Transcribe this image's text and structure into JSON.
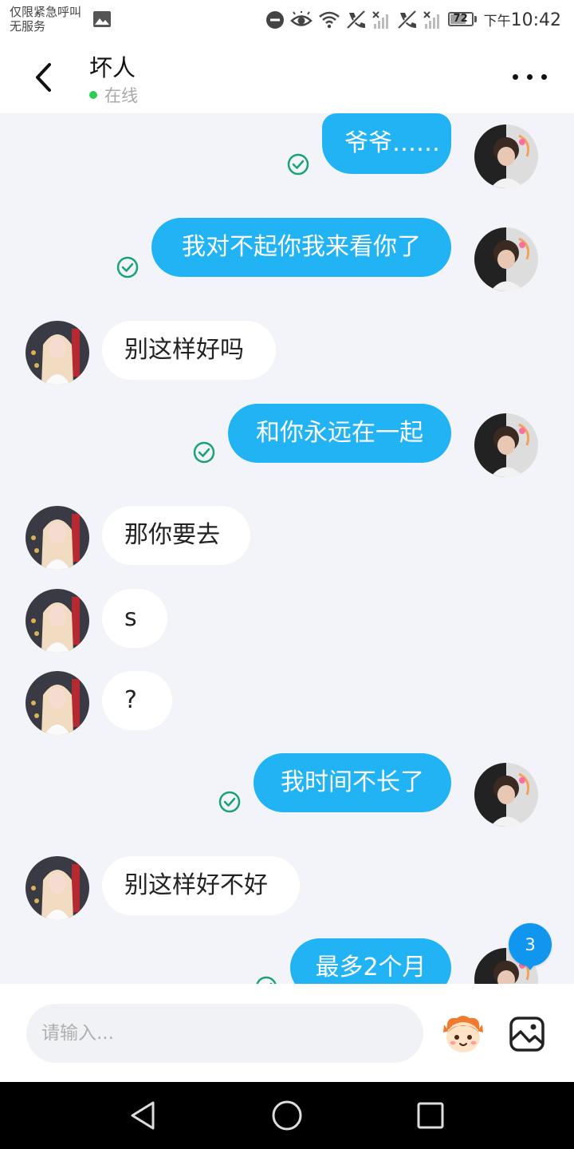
{
  "status_bar": {
    "carrier_line1": "仅限紧急呼叫",
    "carrier_line2": "无服务",
    "battery_level": "72",
    "battery_fraction": 0.72,
    "time_prefix": "下午",
    "time": "10:42"
  },
  "header": {
    "contact_name": "坏人",
    "presence": "在线",
    "presence_color": "#2ecc55"
  },
  "messages": [
    {
      "direction": "outgoing",
      "text": "爷爷……",
      "delivered": true
    },
    {
      "direction": "outgoing",
      "text": "我对不起你我来看你了",
      "delivered": true
    },
    {
      "direction": "incoming",
      "text": "别这样好吗"
    },
    {
      "direction": "outgoing",
      "text": "和你永远在一起",
      "delivered": true
    },
    {
      "direction": "incoming",
      "text": "那你要去"
    },
    {
      "direction": "incoming",
      "text": "s"
    },
    {
      "direction": "incoming",
      "text": "?"
    },
    {
      "direction": "outgoing",
      "text": "我时间不长了",
      "delivered": true
    },
    {
      "direction": "incoming",
      "text": "别这样好不好"
    },
    {
      "direction": "outgoing",
      "text": "最多2个月",
      "delivered": true
    }
  ],
  "unread_badge": "3",
  "composer": {
    "placeholder": "请输入..."
  },
  "icons": {
    "back": "chevron-left-icon",
    "more": "more-dots-icon",
    "delivered": "check-circle-icon",
    "emoji": "emoji-mascot-icon",
    "image": "image-icon"
  },
  "colors": {
    "outgoing_bubble": "#21b3f3",
    "incoming_bubble": "#ffffff",
    "chat_background": "#f2f4f9",
    "delivered_check": "#1aa274",
    "badge": "#1196f0"
  }
}
